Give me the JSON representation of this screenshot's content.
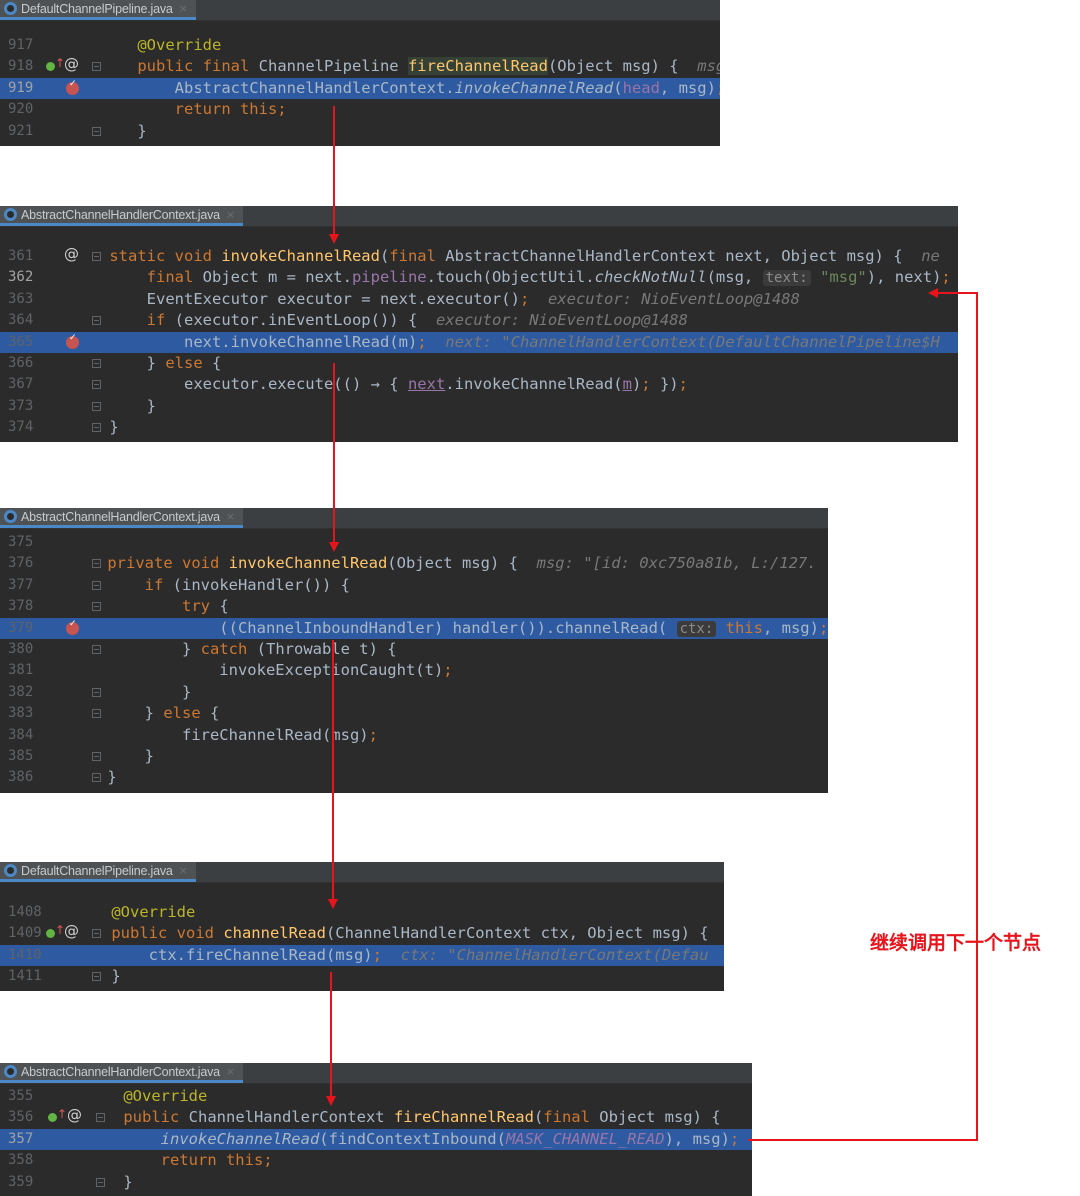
{
  "panels": [
    {
      "tab": "DefaultChannelPipeline.java",
      "lines": [
        {
          "num": "917",
          "segments": [
            {
              "t": "    "
            },
            {
              "t": "@Override",
              "c": "ann"
            }
          ]
        },
        {
          "num": "918",
          "segments": [
            {
              "t": "    "
            },
            {
              "t": "public final ",
              "c": "k"
            },
            {
              "t": "ChannelPipeline "
            },
            {
              "t": "fireChannelRead",
              "c": "fn matchbg"
            },
            {
              "t": "(Object msg) {  "
            },
            {
              "t": "msg:",
              "c": "inl"
            }
          ]
        },
        {
          "num": "919",
          "segments": [
            {
              "t": "        AbstractChannelHandlerContext."
            },
            {
              "t": "invokeChannelRead",
              "c": "it"
            },
            {
              "t": "("
            },
            {
              "t": "head",
              "c": "fld"
            },
            {
              "t": ", msg)"
            },
            {
              "t": ";",
              "c": "k"
            }
          ]
        },
        {
          "num": "920",
          "segments": [
            {
              "t": "        "
            },
            {
              "t": "return this;",
              "c": "k"
            }
          ]
        },
        {
          "num": "921",
          "segments": [
            {
              "t": "    }"
            }
          ]
        }
      ]
    },
    {
      "tab": "AbstractChannelHandlerContext.java",
      "lines": [
        {
          "num": "361",
          "segments": [
            {
              "t": "    "
            },
            {
              "t": "static void ",
              "c": "k"
            },
            {
              "t": "invokeChannelRead",
              "c": "fn"
            },
            {
              "t": "("
            },
            {
              "t": "final ",
              "c": "k"
            },
            {
              "t": "AbstractChannelHandlerContext next, Object msg) {  "
            },
            {
              "t": "ne",
              "c": "inl"
            }
          ]
        },
        {
          "num": "362",
          "segments": [
            {
              "t": "        "
            },
            {
              "t": "final ",
              "c": "k"
            },
            {
              "t": "Object m = next."
            },
            {
              "t": "pipeline",
              "c": "fld"
            },
            {
              "t": ".touch(ObjectUtil."
            },
            {
              "t": "checkNotNull",
              "c": "it"
            },
            {
              "t": "(msg, "
            },
            {
              "t": "text:",
              "c": "hint"
            },
            {
              "t": " "
            },
            {
              "t": "\"msg\"",
              "c": "str"
            },
            {
              "t": "), next)"
            },
            {
              "t": ";",
              "c": "k"
            }
          ]
        },
        {
          "num": "363",
          "segments": [
            {
              "t": "        EventExecutor executor = next.executor()"
            },
            {
              "t": ";",
              "c": "k"
            },
            {
              "t": "  "
            },
            {
              "t": "executor: NioEventLoop@1488",
              "c": "inl"
            }
          ]
        },
        {
          "num": "364",
          "segments": [
            {
              "t": "        "
            },
            {
              "t": "if ",
              "c": "k"
            },
            {
              "t": "(executor.inEventLoop()) {  "
            },
            {
              "t": "executor: NioEventLoop@1488",
              "c": "inl"
            }
          ]
        },
        {
          "num": "365",
          "segments": [
            {
              "t": "            next.invokeChannelRead(m)"
            },
            {
              "t": ";",
              "c": "k"
            },
            {
              "t": "  "
            },
            {
              "t": "next: \"ChannelHandlerContext(DefaultChannelPipeline$H",
              "c": "inl"
            }
          ]
        },
        {
          "num": "366",
          "segments": [
            {
              "t": "        } "
            },
            {
              "t": "else ",
              "c": "k"
            },
            {
              "t": "{"
            }
          ]
        },
        {
          "num": "367",
          "segments": [
            {
              "t": "            executor.execute(() → { "
            },
            {
              "t": "next",
              "c": "fld ul"
            },
            {
              "t": ".invokeChannelRead("
            },
            {
              "t": "m",
              "c": "fld ul"
            },
            {
              "t": ")"
            },
            {
              "t": ";",
              "c": "k"
            },
            {
              "t": " })"
            },
            {
              "t": ";",
              "c": "k"
            }
          ]
        },
        {
          "num": "373",
          "segments": [
            {
              "t": "        }"
            }
          ]
        },
        {
          "num": "374",
          "segments": [
            {
              "t": "    }"
            }
          ]
        }
      ]
    },
    {
      "tab": "AbstractChannelHandlerContext.java",
      "lines": [
        {
          "num": "375",
          "segments": []
        },
        {
          "num": "376",
          "segments": [
            {
              "t": "    "
            },
            {
              "t": "private void ",
              "c": "k"
            },
            {
              "t": "invokeChannelRead",
              "c": "fn"
            },
            {
              "t": "(Object msg) {  "
            },
            {
              "t": "msg: \"[id: 0xc750a81b, L:/127.",
              "c": "inl"
            }
          ]
        },
        {
          "num": "377",
          "segments": [
            {
              "t": "        "
            },
            {
              "t": "if ",
              "c": "k"
            },
            {
              "t": "(invokeHandler()) {"
            }
          ]
        },
        {
          "num": "378",
          "segments": [
            {
              "t": "            "
            },
            {
              "t": "try ",
              "c": "k"
            },
            {
              "t": "{"
            }
          ]
        },
        {
          "num": "379",
          "segments": [
            {
              "t": "                ((ChannelInboundHandler) handler()).channelRead( "
            },
            {
              "t": "ctx:",
              "c": "hint"
            },
            {
              "t": " "
            },
            {
              "t": "this",
              "c": "k"
            },
            {
              "t": ", msg)"
            },
            {
              "t": ";",
              "c": "k"
            }
          ]
        },
        {
          "num": "380",
          "segments": [
            {
              "t": "            } "
            },
            {
              "t": "catch ",
              "c": "k"
            },
            {
              "t": "(Throwable t) {"
            }
          ]
        },
        {
          "num": "381",
          "segments": [
            {
              "t": "                invokeExceptionCaught(t)"
            },
            {
              "t": ";",
              "c": "k"
            }
          ]
        },
        {
          "num": "382",
          "segments": [
            {
              "t": "            }"
            }
          ]
        },
        {
          "num": "383",
          "segments": [
            {
              "t": "        } "
            },
            {
              "t": "else ",
              "c": "k"
            },
            {
              "t": "{"
            }
          ]
        },
        {
          "num": "384",
          "segments": [
            {
              "t": "            fireChannelRead(msg)"
            },
            {
              "t": ";",
              "c": "k"
            }
          ]
        },
        {
          "num": "385",
          "segments": [
            {
              "t": "        }"
            }
          ]
        },
        {
          "num": "386",
          "segments": [
            {
              "t": "    }"
            }
          ]
        }
      ]
    },
    {
      "tab": "DefaultChannelPipeline.java",
      "lines": [
        {
          "num": "1408",
          "segments": [
            {
              "t": "    "
            },
            {
              "t": "@Override",
              "c": "ann"
            }
          ]
        },
        {
          "num": "1409",
          "segments": [
            {
              "t": "    "
            },
            {
              "t": "public void ",
              "c": "k"
            },
            {
              "t": "channelRead",
              "c": "fn"
            },
            {
              "t": "(ChannelHandlerContext ctx, Object msg) {"
            }
          ]
        },
        {
          "num": "1410",
          "segments": [
            {
              "t": "        ctx.fireChannelRead(msg)"
            },
            {
              "t": ";",
              "c": "k"
            },
            {
              "t": "  "
            },
            {
              "t": "ctx: \"ChannelHandlerContext(Defau",
              "c": "inl"
            }
          ]
        },
        {
          "num": "1411",
          "segments": [
            {
              "t": "    }"
            }
          ]
        }
      ]
    },
    {
      "tab": "AbstractChannelHandlerContext.java",
      "lines": [
        {
          "num": "355",
          "segments": [
            {
              "t": "    "
            },
            {
              "t": "@Override",
              "c": "ann"
            }
          ]
        },
        {
          "num": "356",
          "segments": [
            {
              "t": "    "
            },
            {
              "t": "public ",
              "c": "k"
            },
            {
              "t": "ChannelHandlerContext "
            },
            {
              "t": "fireChannelRead",
              "c": "fn"
            },
            {
              "t": "("
            },
            {
              "t": "final ",
              "c": "k"
            },
            {
              "t": "Object msg) {"
            }
          ]
        },
        {
          "num": "357",
          "segments": [
            {
              "t": "        "
            },
            {
              "t": "invokeChannelRead",
              "c": "it"
            },
            {
              "t": "(findContextInbound("
            },
            {
              "t": "MASK_CHANNEL_READ",
              "c": "fld it"
            },
            {
              "t": "), msg)"
            },
            {
              "t": ";",
              "c": "k"
            }
          ]
        },
        {
          "num": "358",
          "segments": [
            {
              "t": "        "
            },
            {
              "t": "return this;",
              "c": "k"
            }
          ]
        },
        {
          "num": "359",
          "segments": [
            {
              "t": "    }"
            }
          ]
        }
      ]
    }
  ],
  "annotation": {
    "label": "继续调用下一个节点"
  },
  "colors": {
    "arrow": "#e8141b",
    "editor_bg": "#2b2b2b",
    "highlight": "#2d5aa0"
  }
}
